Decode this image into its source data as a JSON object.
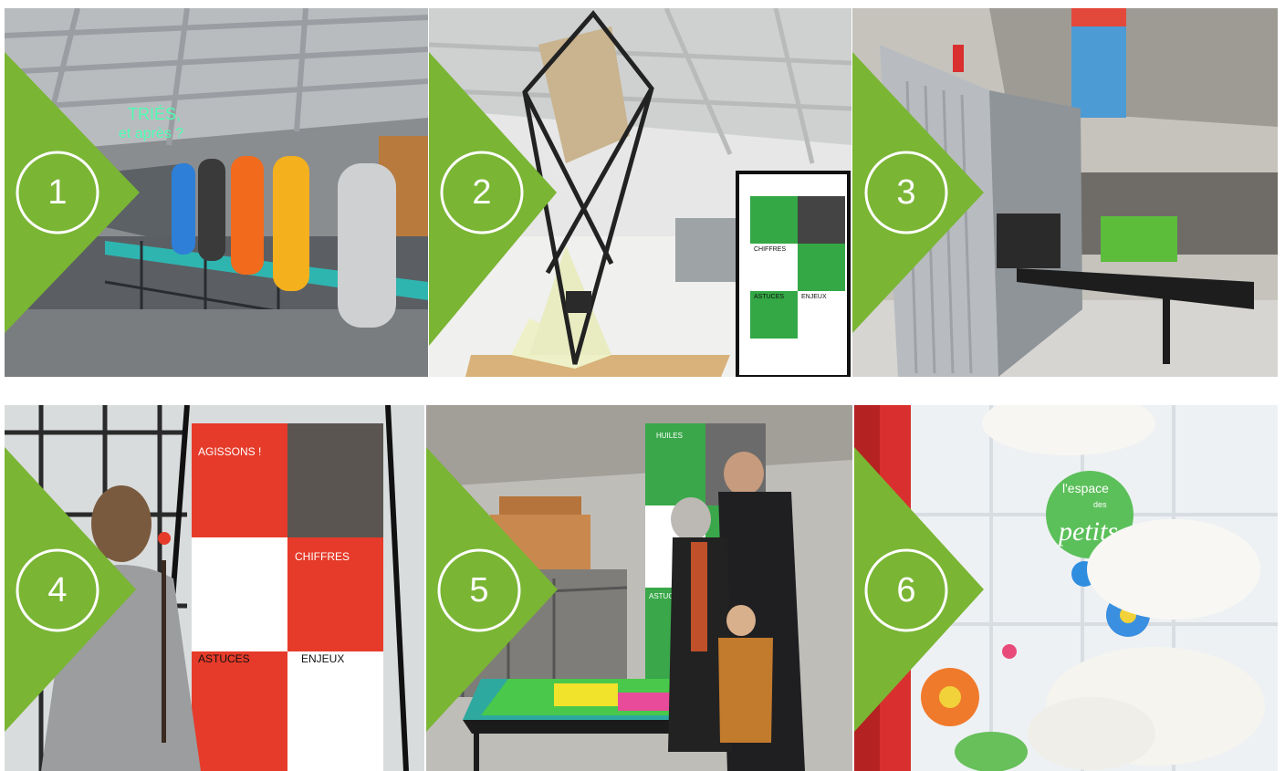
{
  "tiles": [
    {
      "number": "1",
      "caption": "TRIÉS,",
      "caption2": "et après ?"
    },
    {
      "number": "2",
      "sign1": "CHIFFRES",
      "sign2": "ASTUCES",
      "sign3": "ENJEUX"
    },
    {
      "number": "3"
    },
    {
      "number": "4",
      "panel_title": "AGISSONS !",
      "panel_chiffres": "CHIFFRES",
      "panel_astuces": "ASTUCES",
      "panel_enjeux": "ENJEUX"
    },
    {
      "number": "5",
      "panel_title": "HUILES",
      "panel_astuces": "ASTUCES"
    },
    {
      "number": "6",
      "sign_line1": "l'espace",
      "sign_line2": "des",
      "sign_line3": "petits"
    }
  ],
  "colors": {
    "accent_green": "#7ab534",
    "panel_red": "#e63b2a",
    "panel_green": "#3aa84a"
  }
}
